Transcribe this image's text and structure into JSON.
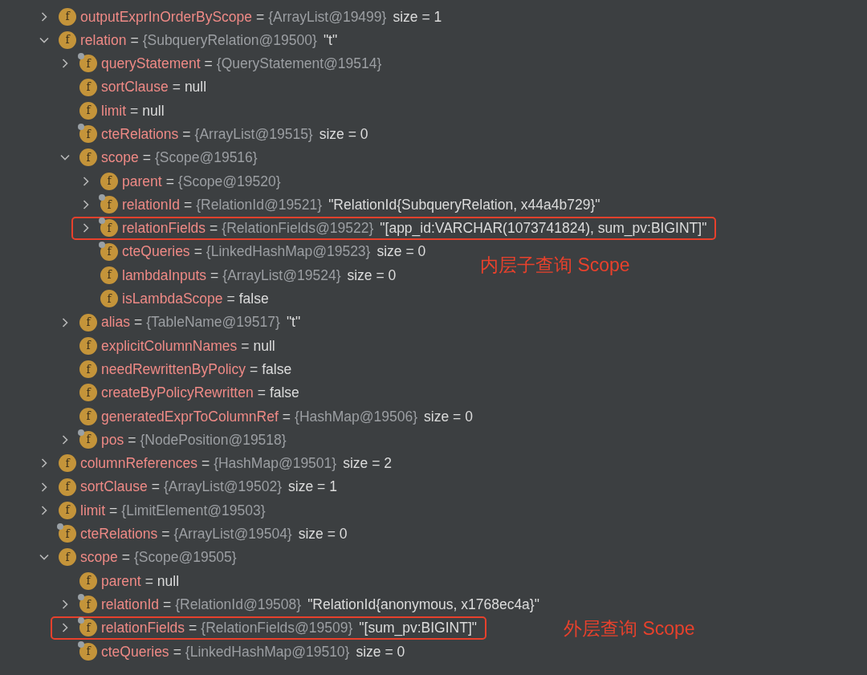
{
  "variables": [
    {
      "icon": "f",
      "name": "outputExprInOrderByScope",
      "sep": "=",
      "ref": "{ArrayList@19499}",
      "value": "size = 1",
      "expanded": false,
      "flagged": false,
      "highlighted": false
    },
    {
      "icon": "f",
      "name": "relation",
      "sep": "=",
      "ref": "{SubqueryRelation@19500}",
      "value": "\"t\"",
      "expanded": true,
      "flagged": false,
      "highlighted": false,
      "children": [
        {
          "icon": "f",
          "name": "queryStatement",
          "sep": "=",
          "ref": "{QueryStatement@19514}",
          "expanded": false,
          "flagged": true,
          "highlighted": false
        },
        {
          "icon": "f",
          "name": "sortClause",
          "sep": "=",
          "value": "null",
          "flagged": false,
          "highlighted": false
        },
        {
          "icon": "f",
          "name": "limit",
          "sep": "=",
          "value": "null",
          "flagged": false,
          "highlighted": false
        },
        {
          "icon": "f",
          "name": "cteRelations",
          "sep": "=",
          "ref": "{ArrayList@19515}",
          "value": "size = 0",
          "flagged": true,
          "highlighted": false
        },
        {
          "icon": "f",
          "name": "scope",
          "sep": "=",
          "ref": "{Scope@19516}",
          "expanded": true,
          "flagged": false,
          "highlighted": false,
          "children": [
            {
              "icon": "f",
              "name": "parent",
              "sep": "=",
              "ref": "{Scope@19520}",
              "expanded": false,
              "flagged": false,
              "highlighted": false
            },
            {
              "icon": "f",
              "name": "relationId",
              "sep": "=",
              "ref": "{RelationId@19521}",
              "value": "\"RelationId{SubqueryRelation, x44a4b729}\"",
              "expanded": false,
              "flagged": true,
              "highlighted": false
            },
            {
              "icon": "f",
              "name": "relationFields",
              "sep": "=",
              "ref": "{RelationFields@19522}",
              "value": "\"[app_id:VARCHAR(1073741824), sum_pv:BIGINT]\"",
              "expanded": false,
              "flagged": true,
              "highlighted": true
            },
            {
              "icon": "f",
              "name": "cteQueries",
              "sep": "=",
              "ref": "{LinkedHashMap@19523}",
              "value": "size = 0",
              "flagged": true,
              "highlighted": false
            },
            {
              "icon": "f",
              "name": "lambdaInputs",
              "sep": "=",
              "ref": "{ArrayList@19524}",
              "value": "size = 0",
              "flagged": false,
              "highlighted": false
            },
            {
              "icon": "f",
              "name": "isLambdaScope",
              "sep": "=",
              "value": "false",
              "flagged": false,
              "highlighted": false
            }
          ]
        },
        {
          "icon": "f",
          "name": "alias",
          "sep": "=",
          "ref": "{TableName@19517}",
          "value": "\"t\"",
          "expanded": false,
          "flagged": false,
          "highlighted": false
        },
        {
          "icon": "f",
          "name": "explicitColumnNames",
          "sep": "=",
          "value": "null",
          "flagged": false,
          "highlighted": false
        },
        {
          "icon": "f",
          "name": "needRewrittenByPolicy",
          "sep": "=",
          "value": "false",
          "flagged": false,
          "highlighted": false
        },
        {
          "icon": "f",
          "name": "createByPolicyRewritten",
          "sep": "=",
          "value": "false",
          "flagged": false,
          "highlighted": false
        },
        {
          "icon": "f",
          "name": "generatedExprToColumnRef",
          "sep": "=",
          "ref": "{HashMap@19506}",
          "value": "size = 0",
          "flagged": false,
          "highlighted": false
        },
        {
          "icon": "f",
          "name": "pos",
          "sep": "=",
          "ref": "{NodePosition@19518}",
          "expanded": false,
          "flagged": true,
          "highlighted": false
        }
      ]
    },
    {
      "icon": "f",
      "name": "columnReferences",
      "sep": "=",
      "ref": "{HashMap@19501}",
      "value": "size = 2",
      "expanded": false,
      "flagged": false,
      "highlighted": false
    },
    {
      "icon": "f",
      "name": "sortClause",
      "sep": "=",
      "ref": "{ArrayList@19502}",
      "value": "size = 1",
      "expanded": false,
      "flagged": false,
      "highlighted": false
    },
    {
      "icon": "f",
      "name": "limit",
      "sep": "=",
      "ref": "{LimitElement@19503}",
      "expanded": false,
      "flagged": false,
      "highlighted": false
    },
    {
      "icon": "f",
      "name": "cteRelations",
      "sep": "=",
      "ref": "{ArrayList@19504}",
      "value": "size = 0",
      "flagged": true,
      "highlighted": false
    },
    {
      "icon": "f",
      "name": "scope",
      "sep": "=",
      "ref": "{Scope@19505}",
      "expanded": true,
      "flagged": false,
      "highlighted": false,
      "children": [
        {
          "icon": "f",
          "name": "parent",
          "sep": "=",
          "value": "null",
          "flagged": false,
          "highlighted": false
        },
        {
          "icon": "f",
          "name": "relationId",
          "sep": "=",
          "ref": "{RelationId@19508}",
          "value": "\"RelationId{anonymous, x1768ec4a}\"",
          "expanded": false,
          "flagged": true,
          "highlighted": false
        },
        {
          "icon": "f",
          "name": "relationFields",
          "sep": "=",
          "ref": "{RelationFields@19509}",
          "value": "\"[sum_pv:BIGINT]\"",
          "expanded": false,
          "flagged": true,
          "highlighted": true
        },
        {
          "icon": "f",
          "name": "cteQueries",
          "sep": "=",
          "ref": "{LinkedHashMap@19510}",
          "value": "size = 0",
          "flagged": true,
          "highlighted": false
        }
      ]
    }
  ],
  "annotations": [
    "内层子查询 Scope",
    "外层查询 Scope"
  ]
}
